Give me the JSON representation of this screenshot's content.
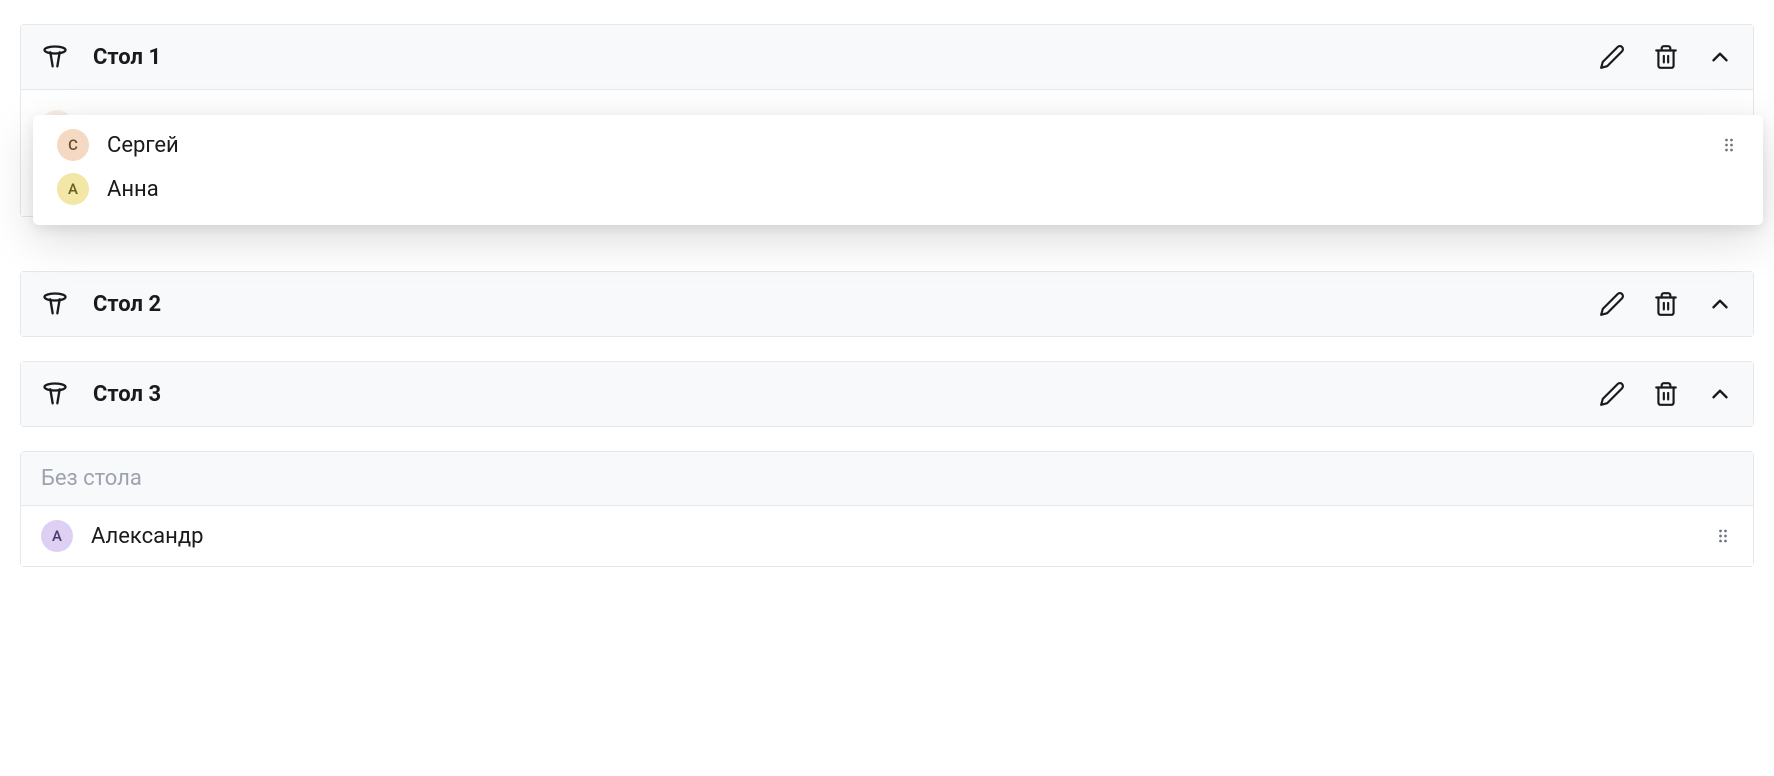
{
  "tables": [
    {
      "title": "Стол 1",
      "ghost_guests": [
        {
          "initial": "С",
          "name": "Сергей",
          "avatar_color": "col-orange"
        },
        {
          "initial": "А",
          "name": "Анна",
          "avatar_color": "col-yellow"
        }
      ],
      "dragging_guests": [
        {
          "initial": "С",
          "name": "Сергей",
          "avatar_color": "col-orange"
        },
        {
          "initial": "А",
          "name": "Анна",
          "avatar_color": "col-yellow"
        }
      ]
    },
    {
      "title": "Стол 2"
    },
    {
      "title": "Стол 3"
    }
  ],
  "unassigned": {
    "title": "Без стола",
    "guests": [
      {
        "initial": "А",
        "name": "Александр",
        "avatar_color": "col-purple"
      }
    ]
  }
}
